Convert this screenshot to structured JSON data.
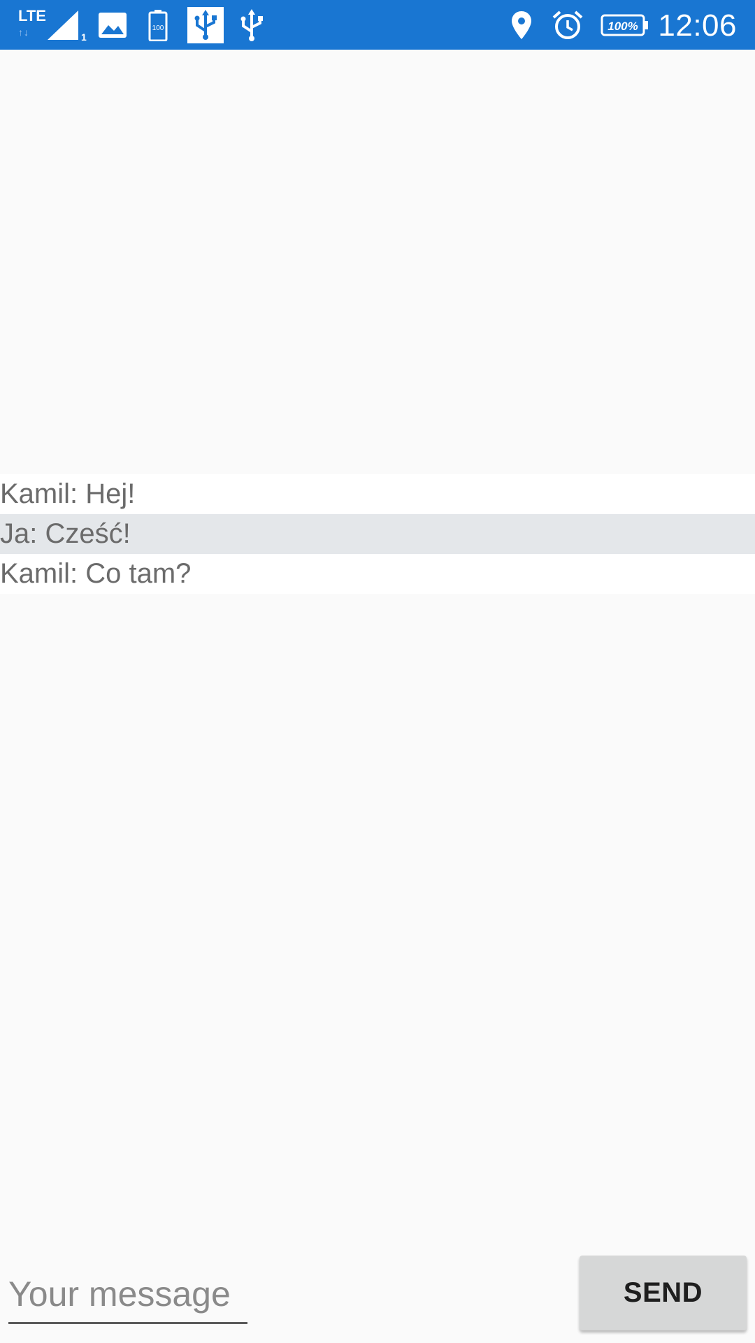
{
  "status_bar": {
    "network_type": "LTE",
    "network_arrows": "↑↓",
    "sim_slot": "1",
    "battery_small_level": "100",
    "battery_percent": "100%",
    "time": "12:06",
    "icons": [
      "lte-icon",
      "signal-icon",
      "image-icon",
      "battery-small-icon",
      "usb-boxed-icon",
      "usb-icon",
      "location-icon",
      "alarm-icon",
      "battery-icon"
    ],
    "background_color": "#1976d2"
  },
  "messages": [
    {
      "text": "Kamil: Hej!"
    },
    {
      "text": "Ja: Cześć!"
    },
    {
      "text": "Kamil: Co tam?"
    }
  ],
  "composer": {
    "placeholder": "Your message",
    "value": "",
    "send_label": "SEND"
  }
}
